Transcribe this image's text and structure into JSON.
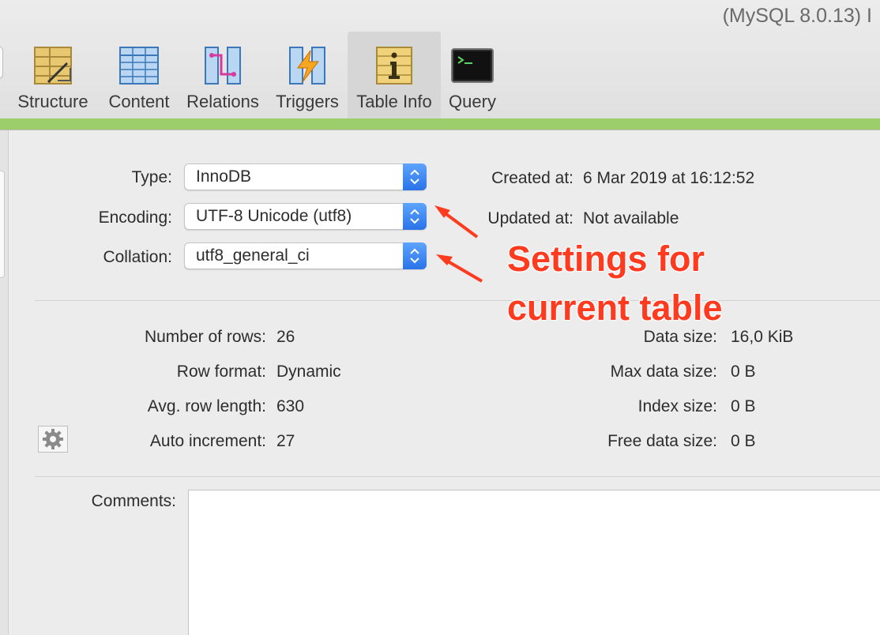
{
  "window": {
    "title": "(MySQL 8.0.13) I"
  },
  "toolbar": {
    "tabs": [
      {
        "label": "Structure",
        "icon": "structure-icon",
        "active": false
      },
      {
        "label": "Content",
        "icon": "content-icon",
        "active": false
      },
      {
        "label": "Relations",
        "icon": "relations-icon",
        "active": false
      },
      {
        "label": "Triggers",
        "icon": "triggers-icon",
        "active": false
      },
      {
        "label": "Table Info",
        "icon": "table-info-icon",
        "active": true
      },
      {
        "label": "Query",
        "icon": "query-icon",
        "active": false
      }
    ]
  },
  "settings": {
    "type": {
      "label": "Type:",
      "value": "InnoDB"
    },
    "encoding": {
      "label": "Encoding:",
      "value": "UTF-8 Unicode (utf8)"
    },
    "collation": {
      "label": "Collation:",
      "value": "utf8_general_ci"
    },
    "created": {
      "label": "Created at:",
      "value": "6 Mar 2019 at 16:12:52"
    },
    "updated": {
      "label": "Updated at:",
      "value": "Not available"
    }
  },
  "stats": {
    "left": [
      {
        "label": "Number of rows:",
        "value": "26"
      },
      {
        "label": "Row format:",
        "value": "Dynamic"
      },
      {
        "label": "Avg. row length:",
        "value": "630"
      },
      {
        "label": "Auto increment:",
        "value": "27"
      }
    ],
    "right": [
      {
        "label": "Data size:",
        "value": "16,0 KiB"
      },
      {
        "label": "Max data size:",
        "value": "0 B"
      },
      {
        "label": "Index size:",
        "value": "0 B"
      },
      {
        "label": "Free data size:",
        "value": "0 B"
      }
    ]
  },
  "comments": {
    "label": "Comments:",
    "value": ""
  },
  "annotation": {
    "line1": "Settings for",
    "line2": "current table",
    "color": "#ff3b1f"
  },
  "colors": {
    "accent_green": "#9ccf6b",
    "stepper_blue": "#2a73e8"
  }
}
